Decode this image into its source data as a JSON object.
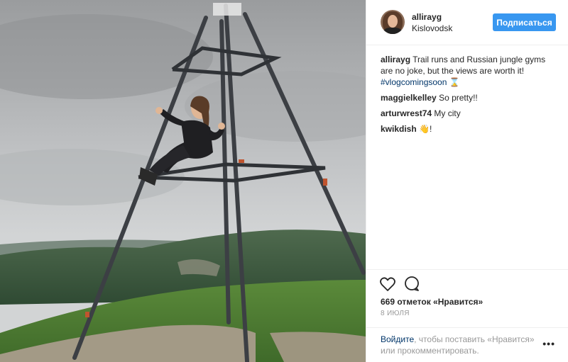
{
  "post": {
    "username": "allirayg",
    "location": "Kislovodsk",
    "follow_label": "Подписаться",
    "caption_user": "allirayg",
    "caption_text": "Trail runs and Russian jungle gyms are no joke, but the views are worth it!",
    "caption_hashtag": "#vlogcomingsoon",
    "caption_emoji": "⌛",
    "comments": [
      {
        "user": "maggielkelley",
        "text": "So pretty!!"
      },
      {
        "user": "arturwrest74",
        "text": "My city"
      },
      {
        "user": "kwikdish",
        "text": "👋!"
      }
    ],
    "likes_text": "669 отметок «Нравится»",
    "date_text": "8 ИЮЛЯ",
    "login_link": "Войдите",
    "login_text": ", чтобы поставить «Нравится» или прокомментировать.",
    "more_label": "•••"
  },
  "icons": {
    "like": "heart-icon",
    "comment": "comment-bubble-icon",
    "more": "more-options-icon"
  },
  "colors": {
    "button_blue": "#3897f0",
    "link_blue": "#003569",
    "text": "#262626",
    "muted": "#999999"
  }
}
